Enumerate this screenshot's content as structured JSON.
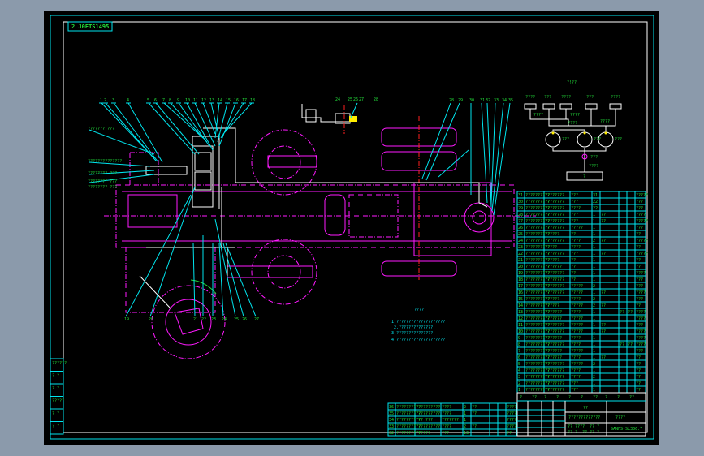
{
  "drawing_code": "2 J0ETS1495",
  "schematic": {
    "title": "?!??",
    "valve_labels": [
      "????",
      "???",
      "????",
      "???",
      "????"
    ],
    "side_labels": [
      "????",
      "????",
      "????",
      "????"
    ],
    "tank_labels": [
      "???",
      "???",
      "???"
    ],
    "lower_labels": [
      "???",
      "????"
    ],
    "box_label": "?"
  },
  "callouts_top": [
    "1",
    "2",
    "3",
    "4",
    "5",
    "6",
    "7",
    "8",
    "9",
    "10",
    "11",
    "12",
    "13",
    "14",
    "15",
    "16",
    "17",
    "18"
  ],
  "callouts_bottom": [
    "19",
    "20",
    "21",
    "22",
    "23",
    "24",
    "25",
    "26",
    "27"
  ],
  "callouts_right": [
    "28",
    "29",
    "30",
    "31",
    "32",
    "33",
    "34",
    "35"
  ],
  "callouts_valve": [
    "24",
    "25",
    "26",
    "27",
    "28"
  ],
  "side_notes": [
    "??????? ???",
    "??????????????",
    "???????? ???",
    "???????? ???",
    "???????? ???"
  ],
  "tech_notes": {
    "title": "????",
    "lines": [
      "1.????????????????????",
      "2.??????????????",
      "3.???????????????",
      "4.????????????????????"
    ]
  },
  "parts_list_right": [
    [
      "31",
      "??????????",
      "????????",
      "???",
      "31",
      "",
      "",
      "",
      "?????"
    ],
    [
      "30",
      "??????????",
      "????????",
      "???",
      "22",
      "",
      "",
      "",
      "???"
    ],
    [
      "29",
      "??????????",
      "????????",
      "????",
      "22",
      "",
      "",
      "",
      "???"
    ],
    [
      "28",
      "??????????",
      "????????",
      "???",
      "1",
      "??",
      "",
      "",
      "????"
    ],
    [
      "27",
      "??????????",
      "????????",
      "???",
      "1",
      "??",
      "",
      "",
      "?????"
    ],
    [
      "26",
      "??????????",
      "????????",
      "?????",
      "1",
      "",
      "",
      "",
      "???"
    ],
    [
      "25",
      "??????????",
      "??????",
      "??",
      "1",
      "",
      "",
      "",
      "??"
    ],
    [
      "24",
      "??????????",
      "????????",
      "????",
      "2",
      "??",
      "",
      "",
      "?????"
    ],
    [
      "23",
      "??????????",
      "?????",
      "????",
      "1",
      "",
      "",
      "",
      "??"
    ],
    [
      "22",
      "??????????",
      "????????",
      "???",
      "1",
      "??",
      "",
      "",
      "?????"
    ],
    [
      "21",
      "??????????",
      "??????",
      "??",
      "1",
      "",
      "",
      "",
      "??"
    ],
    [
      "20",
      "??????????",
      "???????",
      "??",
      "1",
      "",
      "",
      "",
      "??"
    ],
    [
      "19",
      "??????????",
      "????????",
      "??",
      "1",
      "",
      "",
      "",
      "????"
    ],
    [
      "18",
      "??????????",
      "????????",
      "??",
      "1",
      "",
      "",
      "",
      "???"
    ],
    [
      "17",
      "??????????",
      "????????",
      "?????",
      "2",
      "",
      "",
      "",
      "???"
    ],
    [
      "16",
      "??????????",
      "????????",
      "?????",
      "1",
      "??",
      "",
      "",
      "????"
    ],
    [
      "15",
      "??????????",
      "??????",
      "????",
      "2",
      "",
      "",
      "",
      "???"
    ],
    [
      "14",
      "??????????",
      "??????",
      "?????",
      "2",
      "??",
      "",
      "",
      "??"
    ],
    [
      "13",
      "??????????",
      "???????",
      "????",
      "1",
      "",
      "??",
      "??",
      "????"
    ],
    [
      "12",
      "??????????",
      "???????",
      "?????",
      "1",
      "",
      "",
      "",
      "????"
    ],
    [
      "11",
      "??????????",
      "????????",
      "?????",
      "1",
      "??",
      "",
      "",
      "???"
    ],
    [
      "10",
      "??????????",
      "????????",
      "?????",
      "1",
      "??",
      "",
      "",
      "????"
    ],
    [
      "9",
      "??????????",
      "???????",
      "????",
      "1",
      "",
      "",
      "",
      "????"
    ],
    [
      "8",
      "??????????",
      "????????",
      "????",
      "1",
      "",
      "??",
      "??",
      "????"
    ],
    [
      "7",
      "??????????",
      "???????",
      "?????",
      "1",
      "",
      "",
      "",
      "???"
    ],
    [
      "6",
      "??????????",
      "???????",
      "????",
      "1",
      "??",
      "",
      "",
      "??"
    ],
    [
      "5",
      "??????????",
      "????????",
      "?????",
      "2",
      "",
      "",
      "",
      "??"
    ],
    [
      "4",
      "??????????",
      "????????",
      "????",
      "1",
      "",
      "",
      "",
      "??"
    ],
    [
      "3",
      "??????????",
      "????????",
      "????",
      "2",
      "",
      "",
      "",
      "??"
    ],
    [
      "2",
      "??????????",
      "????????",
      "???",
      "1",
      "",
      "",
      "",
      "??"
    ],
    [
      "1",
      "??????????",
      "????????",
      "???",
      "1",
      "",
      "",
      "",
      "??"
    ]
  ],
  "parts_list_bottom": [
    [
      "36",
      "??????????",
      "??????????",
      "????",
      "2",
      "??",
      "",
      "",
      "????"
    ],
    [
      "35",
      "??????????",
      "??????????",
      "????",
      "1",
      "??",
      "",
      "",
      "????"
    ],
    [
      "34",
      "??????????",
      "??? ???",
      "???????",
      "1",
      "",
      "",
      "",
      "????"
    ],
    [
      "33",
      "??????????",
      "??????????",
      "????",
      "2",
      "??",
      "",
      "",
      "????"
    ],
    [
      "32",
      "??????????",
      "??????",
      "???",
      "13",
      "",
      "",
      "",
      "??"
    ]
  ],
  "title_block": {
    "header_cells": [
      "?",
      "??",
      "?",
      "?",
      "?",
      "?",
      "??",
      "?",
      "?",
      "??"
    ],
    "title": "??",
    "drawing_name": "?????????????",
    "company": "????",
    "drawing_number": "SANFS-SL306.7",
    "sign_cells": [
      "??",
      "???",
      "?",
      "??",
      "?",
      "??",
      "?",
      "??",
      "??",
      "?"
    ]
  },
  "left_table": [
    "??????",
    "? ?",
    "? ?",
    "?????",
    "? ?",
    "? ?"
  ]
}
